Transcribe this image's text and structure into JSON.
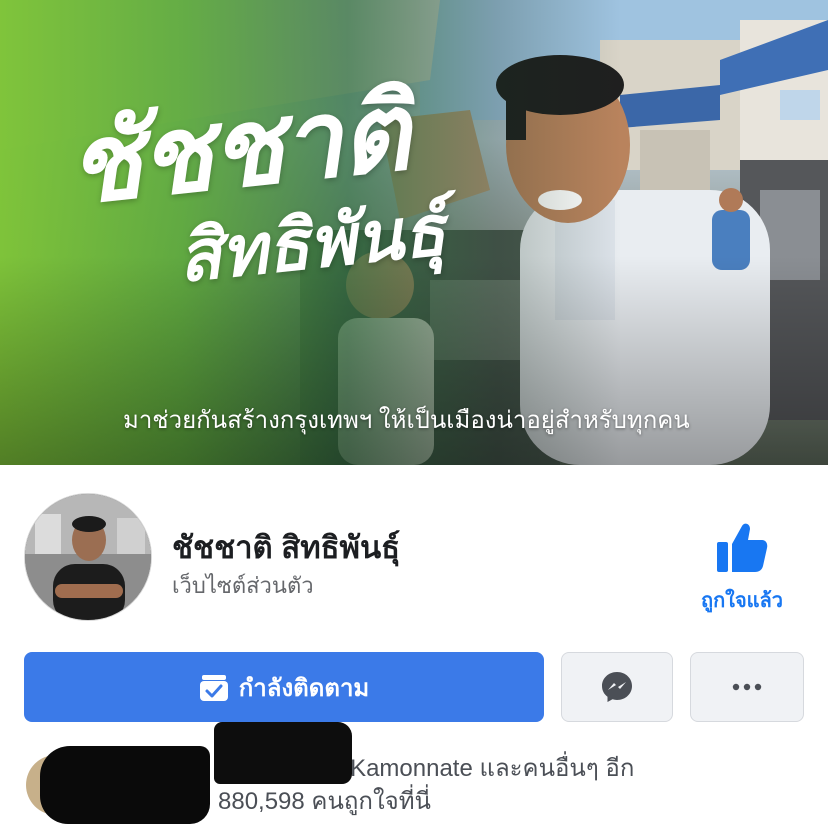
{
  "cover": {
    "title_line1": "ชัชชาติ",
    "title_line2": "สิทธิพันธุ์",
    "slogan": "มาช่วยกันสร้างกรุงเทพฯ ให้เป็นเมืองน่าอยู่สำหรับทุกคน",
    "colors": {
      "green_start": "#7ec438",
      "green_mid": "#5caa3a"
    }
  },
  "profile": {
    "name": "ชัชชาติ สิทธิพันธุ์",
    "category": "เว็บไซต์ส่วนตัว",
    "avatar_icon": "profile-photo"
  },
  "like": {
    "label": "ถูกใจแล้ว",
    "icon": "thumbs-up-icon",
    "color": "#1877f2"
  },
  "actions": {
    "follow_label": "กำลังติดตาม",
    "follow_icon": "following-check-icon",
    "follow_color": "#3b7ae8",
    "messenger_icon": "messenger-icon",
    "more_icon": "more-dots-icon"
  },
  "social": {
    "line1": "Lee, Mutita, Kamonnate และคนอื่นๆ อีก",
    "line2": "880,598 คนถูกใจที่นี่"
  }
}
